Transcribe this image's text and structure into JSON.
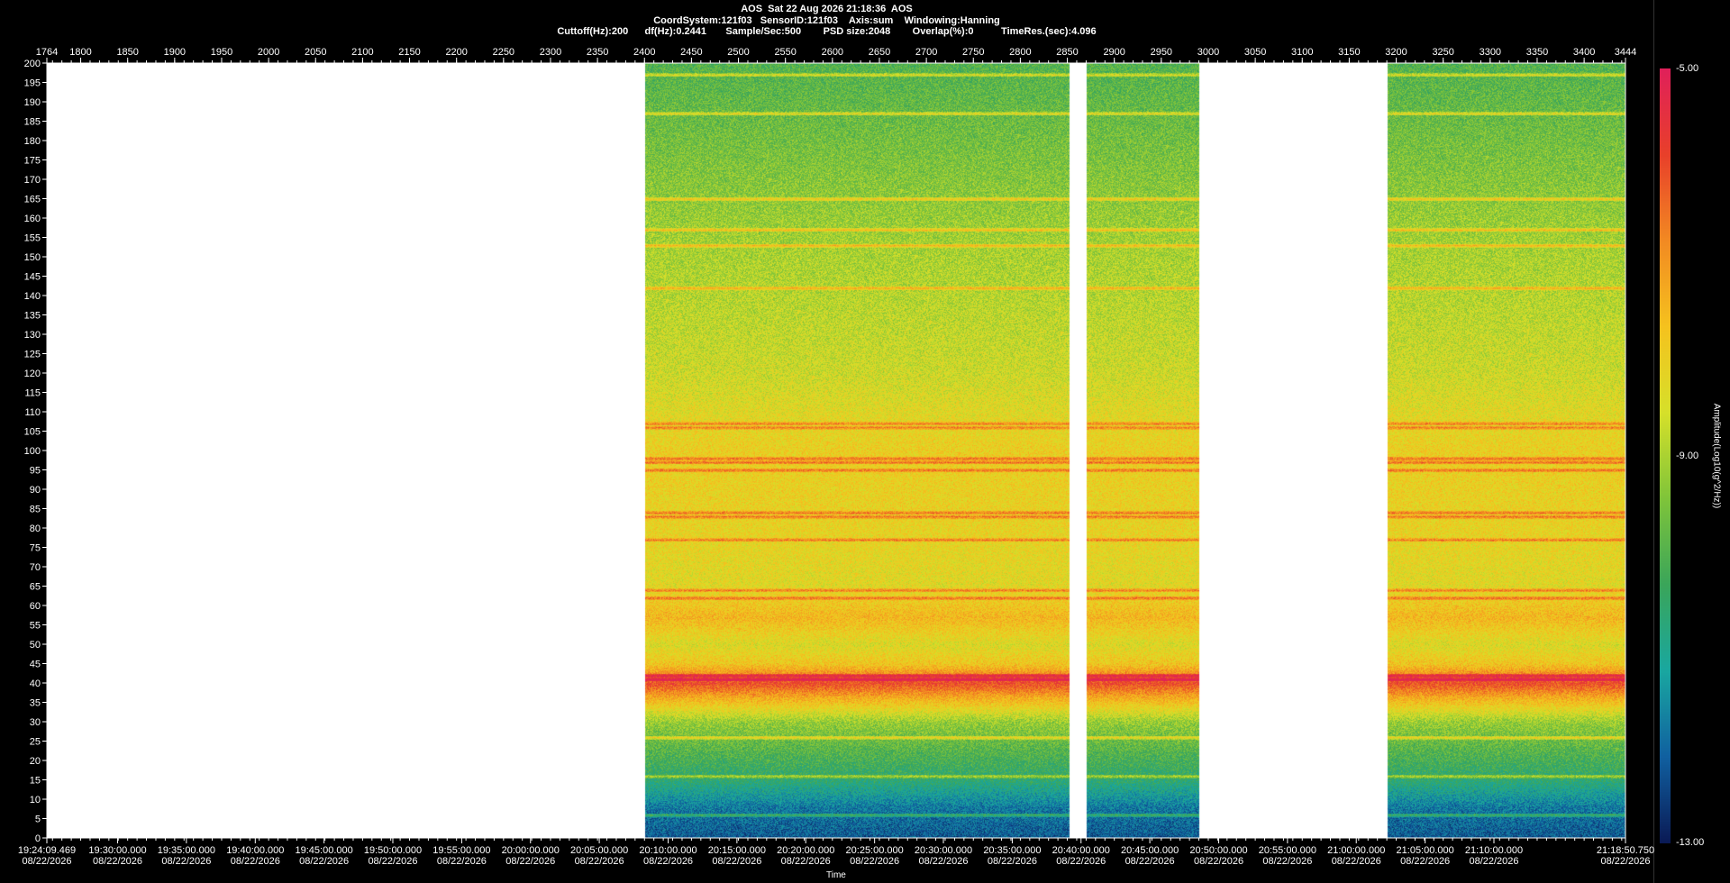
{
  "header": {
    "line1": "AOS  Sat 22 Aug 2026 21:18:36  AOS",
    "line2": "CoordSystem:121f03   SensorID:121f03    Axis:sum    Windowing:Hanning",
    "line3": "Cuttoff(Hz):200      df(Hz):0.2441       Sample/Sec:500        PSD size:2048        Overlap(%):0          TimeRes.(sec):4.096"
  },
  "chart_data": {
    "type": "heatmap",
    "title": "AOS  Sat 22 Aug 2026 21:18:36  AOS",
    "xlabel": "Time",
    "ylabel": "",
    "colorbar_label": "Amplitude(Log10(g^2/Hz))",
    "colorbar_ticks": [
      "-5.00",
      "-9.00",
      "-13.00"
    ],
    "colorbar_range": [
      -13,
      -5
    ],
    "ylim": [
      0,
      200
    ],
    "y_ticks": [
      0,
      5,
      10,
      15,
      20,
      25,
      30,
      35,
      40,
      45,
      50,
      55,
      60,
      65,
      70,
      75,
      80,
      85,
      90,
      95,
      100,
      105,
      110,
      115,
      120,
      125,
      130,
      135,
      140,
      145,
      150,
      155,
      160,
      165,
      170,
      175,
      180,
      185,
      190,
      195,
      200
    ],
    "index_range": [
      1764,
      3444
    ],
    "index_ticks": [
      1764,
      1800,
      1850,
      1900,
      1950,
      2000,
      2050,
      2100,
      2150,
      2200,
      2250,
      2300,
      2350,
      2400,
      2450,
      2500,
      2550,
      2600,
      2650,
      2700,
      2750,
      2800,
      2850,
      2900,
      2950,
      3000,
      3050,
      3100,
      3150,
      3200,
      3250,
      3300,
      3350,
      3400,
      3444
    ],
    "time_ticks": [
      {
        "index": 1764,
        "time": "19:24:09.469",
        "date": "08/22/2026"
      },
      {
        "index": 1839.3,
        "time": "19:30:00.000",
        "date": "08/22/2026"
      },
      {
        "index": 1912.5,
        "time": "19:35:00.000",
        "date": "08/22/2026"
      },
      {
        "index": 1985.8,
        "time": "19:40:00.000",
        "date": "08/22/2026"
      },
      {
        "index": 2059.0,
        "time": "19:45:00.000",
        "date": "08/22/2026"
      },
      {
        "index": 2132.2,
        "time": "19:50:00.000",
        "date": "08/22/2026"
      },
      {
        "index": 2205.5,
        "time": "19:55:00.000",
        "date": "08/22/2026"
      },
      {
        "index": 2278.7,
        "time": "20:00:00.000",
        "date": "08/22/2026"
      },
      {
        "index": 2351.9,
        "time": "20:05:00.000",
        "date": "08/22/2026"
      },
      {
        "index": 2425.2,
        "time": "20:10:00.000",
        "date": "08/22/2026"
      },
      {
        "index": 2498.4,
        "time": "20:15:00.000",
        "date": "08/22/2026"
      },
      {
        "index": 2571.6,
        "time": "20:20:00.000",
        "date": "08/22/2026"
      },
      {
        "index": 2644.9,
        "time": "20:25:00.000",
        "date": "08/22/2026"
      },
      {
        "index": 2718.1,
        "time": "20:30:00.000",
        "date": "08/22/2026"
      },
      {
        "index": 2791.4,
        "time": "20:35:00.000",
        "date": "08/22/2026"
      },
      {
        "index": 2864.6,
        "time": "20:40:00.000",
        "date": "08/22/2026"
      },
      {
        "index": 2937.8,
        "time": "20:45:00.000",
        "date": "08/22/2026"
      },
      {
        "index": 3011.1,
        "time": "20:50:00.000",
        "date": "08/22/2026"
      },
      {
        "index": 3084.3,
        "time": "20:55:00.000",
        "date": "08/22/2026"
      },
      {
        "index": 3157.5,
        "time": "21:00:00.000",
        "date": "08/22/2026"
      },
      {
        "index": 3230.8,
        "time": "21:05:00.000",
        "date": "08/22/2026"
      },
      {
        "index": 3304.0,
        "time": "21:10:00.000",
        "date": "08/22/2026"
      },
      {
        "index": 3444,
        "time": "21:18:50.750",
        "date": "08/22/2026"
      }
    ],
    "data_segments": [
      {
        "start_index": 2400,
        "end_index": 2852
      },
      {
        "start_index": 2870,
        "end_index": 2990
      },
      {
        "start_index": 3190,
        "end_index": 3444
      }
    ],
    "tonal_lines_hz": [
      6,
      16,
      26,
      41,
      42,
      62,
      64,
      77,
      83,
      84,
      95,
      97,
      98,
      106,
      107,
      142,
      153,
      157,
      165,
      187,
      197
    ],
    "level_profile": [
      {
        "hz": 0,
        "level": -12.2
      },
      {
        "hz": 8,
        "level": -11.8
      },
      {
        "hz": 15,
        "level": -10.6
      },
      {
        "hz": 22,
        "level": -10.0
      },
      {
        "hz": 30,
        "level": -9.2
      },
      {
        "hz": 36,
        "level": -7.4
      },
      {
        "hz": 40,
        "level": -6.0
      },
      {
        "hz": 45,
        "level": -7.8
      },
      {
        "hz": 50,
        "level": -8.4
      },
      {
        "hz": 57,
        "level": -7.5
      },
      {
        "hz": 65,
        "level": -8.3
      },
      {
        "hz": 80,
        "level": -8.1
      },
      {
        "hz": 100,
        "level": -8.0
      },
      {
        "hz": 120,
        "level": -8.6
      },
      {
        "hz": 150,
        "level": -9.0
      },
      {
        "hz": 175,
        "level": -9.5
      },
      {
        "hz": 200,
        "level": -10.0
      }
    ],
    "grid": false
  },
  "colors": {
    "background": "#000000",
    "no_data": "#ffffff",
    "colormap": [
      "#0a1a55",
      "#1060a0",
      "#19a7a0",
      "#3aa55a",
      "#7fc43a",
      "#d6e02a",
      "#f5c21e",
      "#f28a22",
      "#e8402a",
      "#e0205a"
    ]
  }
}
